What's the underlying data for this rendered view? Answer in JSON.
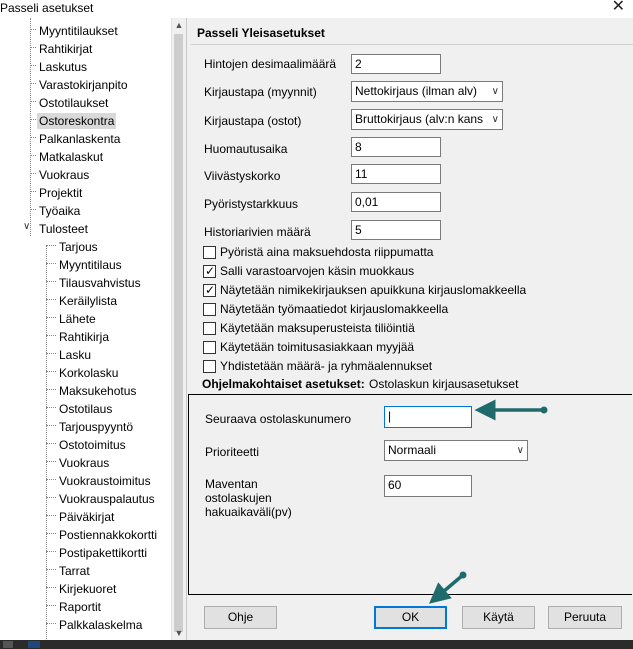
{
  "window": {
    "title": "Passeli asetukset",
    "close_label": "✕"
  },
  "tree": {
    "top_items": [
      {
        "label": "Myyntitilaukset"
      },
      {
        "label": "Rahtikirjat"
      },
      {
        "label": "Laskutus"
      },
      {
        "label": "Varastokirjanpito"
      },
      {
        "label": "Ostotilaukset"
      },
      {
        "label": "Ostoreskontra",
        "selected": true
      },
      {
        "label": "Palkanlaskenta"
      },
      {
        "label": "Matkalaskut"
      },
      {
        "label": "Vuokraus"
      },
      {
        "label": "Projektit"
      },
      {
        "label": "Työaika"
      }
    ],
    "expanded_item": {
      "label": "Tulosteet",
      "expander": "∨"
    },
    "sub_items": [
      {
        "label": "Tarjous"
      },
      {
        "label": "Myyntitilaus"
      },
      {
        "label": "Tilausvahvistus"
      },
      {
        "label": "Keräilylista"
      },
      {
        "label": "Lähete"
      },
      {
        "label": "Rahtikirja"
      },
      {
        "label": "Lasku"
      },
      {
        "label": "Korkolasku"
      },
      {
        "label": "Maksukehotus"
      },
      {
        "label": "Ostotilaus"
      },
      {
        "label": "Tarjouspyyntö"
      },
      {
        "label": "Ostotoimitus"
      },
      {
        "label": "Vuokraus"
      },
      {
        "label": "Vuokraustoimitus"
      },
      {
        "label": "Vuokrauspalautus"
      },
      {
        "label": "Päiväkirjat"
      },
      {
        "label": "Postiennakkokortti"
      },
      {
        "label": "Postipakettikortti"
      },
      {
        "label": "Tarrat"
      },
      {
        "label": "Kirjekuoret"
      },
      {
        "label": "Raportit"
      },
      {
        "label": "Palkkalaskelma"
      }
    ]
  },
  "panel": {
    "title": "Passeli Yleisasetukset",
    "decimal_label": "Hintojen desimaalimäärä",
    "decimal_value": "2",
    "sales_mode_label": "Kirjaustapa (myynnit)",
    "sales_mode_value": "Nettokirjaus (ilman alv)",
    "purchase_mode_label": "Kirjaustapa (ostot)",
    "purchase_mode_value": "Bruttokirjaus (alv:n kans",
    "notice_label": "Huomautusaika",
    "notice_value": "8",
    "interest_label": "Viivästyskorko",
    "interest_value": "11",
    "rounding_label": "Pyöristystarkkuus",
    "rounding_value": "0,01",
    "history_label": "Historiarivien määrä",
    "history_value": "5",
    "checkboxes": [
      {
        "label": "Pyöristä aina maksuehdosta riippumatta",
        "checked": false
      },
      {
        "label": "Salli varastoarvojen käsin muokkaus",
        "checked": true
      },
      {
        "label": "Näytetään nimikekirjauksen apuikkuna kirjauslomakkeella",
        "checked": true
      },
      {
        "label": "Näytetään työmaatiedot kirjauslomakkeella",
        "checked": false
      },
      {
        "label": "Käytetään maksuperusteista tiliöintiä",
        "checked": false
      },
      {
        "label": "Käytetään toimitusasiakkaan myyjää",
        "checked": false
      },
      {
        "label": "Yhdistetään määrä- ja ryhmäalennukset",
        "checked": false
      }
    ],
    "program_settings_label": "Ohjelmakohtaiset asetukset:",
    "program_settings_value": "Ostolaskun kirjausasetukset"
  },
  "inner": {
    "next_number_label": "Seuraava ostolaskunumero",
    "next_number_value": "|",
    "priority_label": "Prioriteetti",
    "priority_value": "Normaali",
    "maventa_label_1": "Maventan",
    "maventa_label_2": "ostolaskujen",
    "maventa_label_3": "hakuaikaväli(pv)",
    "maventa_value": "60"
  },
  "buttons": {
    "help": "Ohje",
    "ok": "OK",
    "apply": "Käytä",
    "cancel": "Peruuta"
  },
  "colors": {
    "arrow": "#1f6b6b",
    "selected_bg": "#d9d9d9",
    "focus": "#0078d7"
  }
}
